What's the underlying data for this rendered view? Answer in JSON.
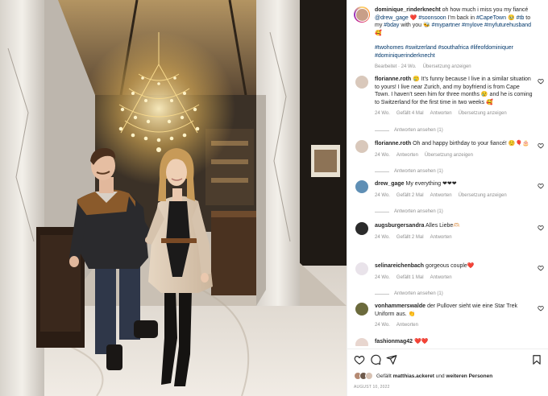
{
  "post": {
    "author": "dominique_rinderknecht",
    "caption_line1": "oh how much i miss you my fiancé",
    "caption_mention": "@drew_gage",
    "caption_emoji1": "❤️",
    "caption_tag1": "#soonsoon",
    "caption_text2": "I’m back in",
    "caption_tag2": "#CapeTown",
    "caption_emoji2": "🥹",
    "caption_tag3": "#tb",
    "caption_text3": "to my",
    "caption_tag4": "#bday",
    "caption_text4": "with you",
    "caption_emoji3": "🐝",
    "caption_tag5": "#mypartner",
    "caption_tag6": "#mylove",
    "caption_tag7": "#myfuturehusband",
    "caption_emoji4": "🥰",
    "hashtags_line1": "#twohomes #switzerland #southafrica #lifeofdominiquer",
    "hashtags_line2": "#dominiquerinderknecht",
    "edited": "Bearbeitet · 24 Wo.",
    "translate": "Übersetzung anzeigen"
  },
  "comments": [
    {
      "user": "florianne.roth",
      "text": "🥲 It’s funny because I live in a similar situation to yours! I live near Zurich, and my boyfriend is from Cape Town. I haven’t seen him for three months 😢 and he is coming to Switzerland for the first time in two weeks 🥰",
      "age": "24 Wo.",
      "likes": "Gefällt 4 Mal",
      "reply": "Antworten",
      "translate": "Übersetzung anzeigen",
      "replies": "Antworten ansehen (1)",
      "avatar_color": "#d9c8bb"
    },
    {
      "user": "florianne.roth",
      "text": "Oh and happy birthday to your fiancé! ☺️🎈🎂",
      "age": "24 Wo.",
      "likes": "",
      "reply": "Antworten",
      "translate": "Übersetzung anzeigen",
      "replies": "Antworten ansehen (1)",
      "avatar_color": "#d9c8bb"
    },
    {
      "user": "drew_gage",
      "text": "My everything ❤❤❤",
      "age": "24 Wo.",
      "likes": "Gefällt 2 Mal",
      "reply": "Antworten",
      "translate": "Übersetzung anzeigen",
      "replies": "Antworten ansehen (1)",
      "avatar_color": "#5f8fb5"
    },
    {
      "user": "augsburgersandra",
      "text": "Alles Liebe🫶🏻",
      "age": "24 Wo.",
      "likes": "Gefällt 2 Mal",
      "reply": "Antworten",
      "translate": "",
      "replies": "",
      "avatar_color": "#2b2b2b"
    },
    {
      "user": "selinareichenbach",
      "text": "gorgeous couple❤️",
      "age": "24 Wo.",
      "likes": "Gefällt 1 Mal",
      "reply": "Antworten",
      "translate": "",
      "replies": "Antworten ansehen (1)",
      "avatar_color": "#e9e3ea"
    },
    {
      "user": "vonhammerswalde",
      "text": "der Pullover sieht wie eine Star Trek Uniform aus. 👏",
      "age": "24 Wo.",
      "likes": "",
      "reply": "Antworten",
      "translate": "",
      "replies": "",
      "avatar_color": "#6b6a3c"
    },
    {
      "user": "fashionmag42",
      "text": "❤️❤️",
      "age": "",
      "likes": "",
      "reply": "",
      "translate": "",
      "replies": "",
      "avatar_color": "#e8d6cf"
    }
  ],
  "footer": {
    "likes_prefix": "Gefällt",
    "likes_user": "matthias.ackeret",
    "likes_mid": "und",
    "likes_others": "weiteren Personen",
    "date": "AUGUST 10, 2022"
  },
  "icons": [
    "heart-icon",
    "comment-icon",
    "share-icon",
    "bookmark-icon"
  ],
  "colors": {
    "link": "#00376b",
    "muted": "#8e8e8e",
    "text": "#262626"
  }
}
